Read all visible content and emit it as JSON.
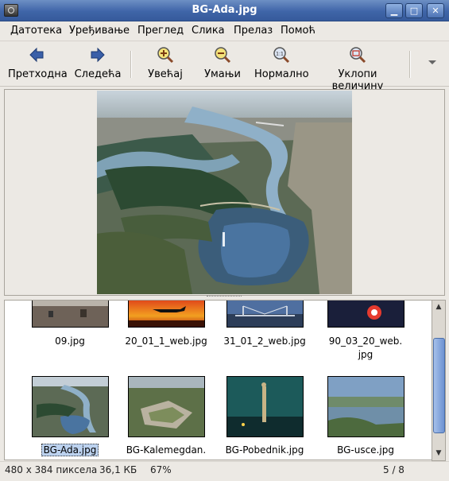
{
  "window": {
    "title": "BG-Ada.jpg",
    "minimize": "▁",
    "maximize": "□",
    "close": "✕"
  },
  "menu": [
    {
      "label": "Датотека"
    },
    {
      "label": "Уређивање"
    },
    {
      "label": "Преглед"
    },
    {
      "label": "Слика"
    },
    {
      "label": "Прелаз"
    },
    {
      "label": "Помоћ"
    }
  ],
  "toolbar": {
    "prev": "Претходна",
    "next": "Следећа",
    "zoom_in": "Увећај",
    "zoom_out": "Умањи",
    "normal": "Нормално",
    "fit": "Уклопи величину",
    "normal_icon_text": "1:1"
  },
  "gallery": {
    "row1": [
      "09.jpg",
      "20_01_1_web.jpg",
      "31_01_2_web.jpg",
      "90_03_20_web.\njpg"
    ],
    "row2": [
      "BG-Ada.jpg",
      "BG-Kalemegdan.",
      "BG-Pobednik.jpg",
      "BG-usce.jpg"
    ],
    "selected": "BG-Ada.jpg"
  },
  "status": {
    "dimensions": "480 x 384 пиксела",
    "size": "36,1 КБ",
    "zoom": "67%",
    "position": "5 / 8"
  }
}
